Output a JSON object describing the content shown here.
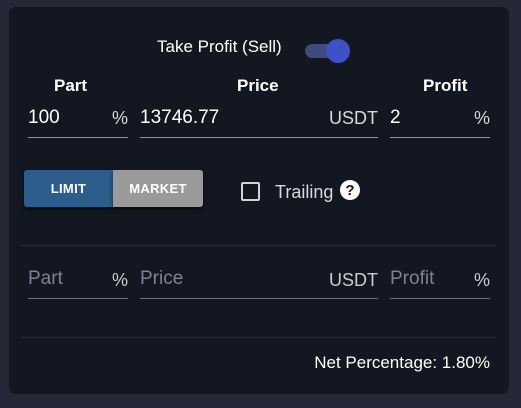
{
  "header": {
    "take_profit_label": "Take Profit (Sell)",
    "take_profit_enabled": true
  },
  "columns": {
    "part": "Part",
    "price": "Price",
    "profit": "Profit"
  },
  "target_row": {
    "part_value": "100",
    "part_unit": "%",
    "price_value": "13746.77",
    "price_unit": "USDT",
    "profit_value": "2",
    "profit_unit": "%"
  },
  "order_type": {
    "limit_label": "LIMIT",
    "market_label": "MARKET",
    "selected": "LIMIT"
  },
  "trailing": {
    "label": "Trailing",
    "checked": false,
    "help_glyph": "?"
  },
  "new_row": {
    "part_placeholder": "Part",
    "part_unit": "%",
    "price_placeholder": "Price",
    "price_unit": "USDT",
    "profit_placeholder": "Profit",
    "profit_unit": "%"
  },
  "footer": {
    "net_percentage": "Net Percentage: 1.80%"
  },
  "colors": {
    "background": "#252836",
    "panel": "#131722",
    "limit_active": "#2d5d8c",
    "market_inactive": "#9a9a9a",
    "toggle_knob": "#3f51c9"
  }
}
